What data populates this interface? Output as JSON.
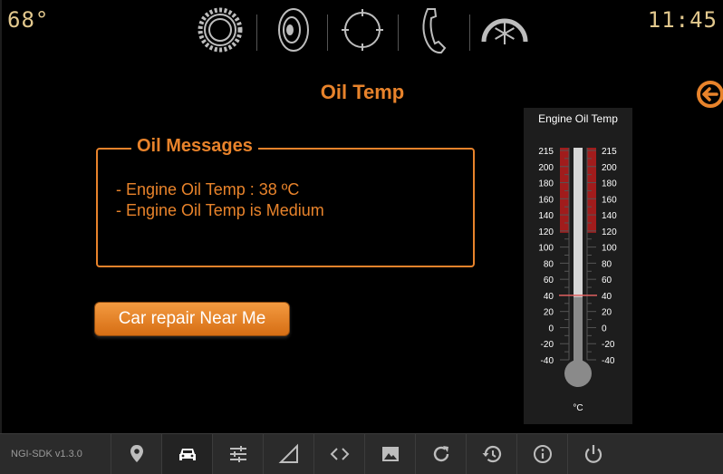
{
  "status": {
    "temperature": "68°",
    "time": "11:45"
  },
  "top_icons": [
    "gear-icon",
    "speaker-icon",
    "crosshair-icon",
    "phone-icon",
    "climate-fan-icon"
  ],
  "page": {
    "title": "Oil Temp"
  },
  "messages": {
    "legend": "Oil Messages",
    "lines": [
      "- Engine Oil Temp : 38 ºC",
      "- Engine Oil Temp is Medium"
    ]
  },
  "action": {
    "label": "Car repair Near Me"
  },
  "gauge": {
    "title": "Engine Oil Temp",
    "unit": "°C",
    "ticks": [
      "215",
      "200",
      "180",
      "160",
      "140",
      "120",
      "100",
      "80",
      "60",
      "40",
      "20",
      "0",
      "-20",
      "-40"
    ],
    "value": 38,
    "threshold": 40,
    "range": [
      -40,
      215
    ],
    "red_zone_from": 120
  },
  "bottom_nav": {
    "version": "NGI-SDK v1.3.0",
    "items": [
      "location-pin-icon",
      "car-icon",
      "sliders-icon",
      "signal-icon",
      "code-icon",
      "image-icon",
      "refresh-icon",
      "history-icon",
      "info-icon",
      "power-icon"
    ],
    "active": "car-icon"
  },
  "colors": {
    "accent": "#e8832b",
    "status_text": "#e3c98e",
    "gauge_red": "#a11c1c"
  }
}
